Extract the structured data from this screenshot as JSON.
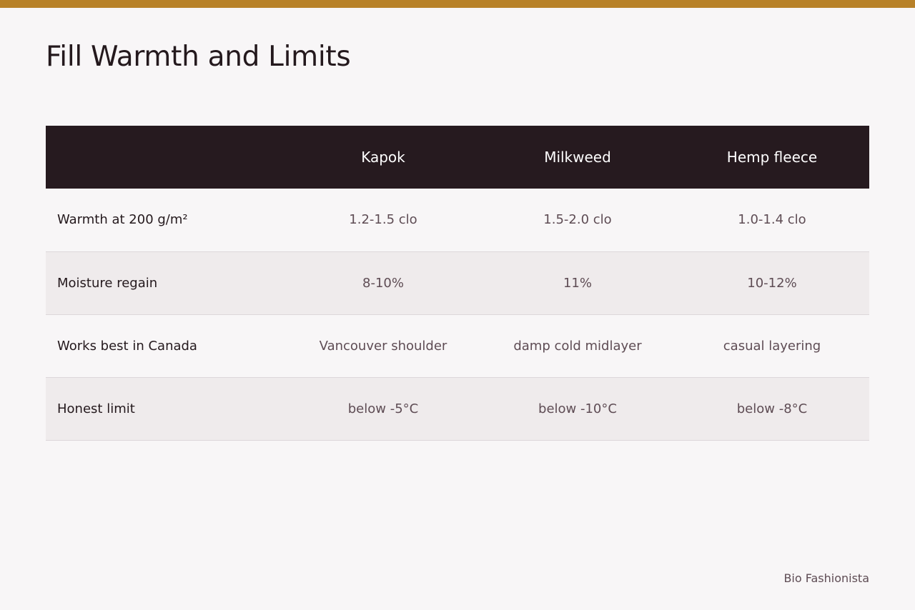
{
  "page": {
    "title": "Fill Warmth and Limits",
    "brand": "Bio Fashionista",
    "accent_color": "#b88128",
    "header_bg_color": "#261a1f"
  },
  "table": {
    "columns": [
      "",
      "Kapok",
      "Milkweed",
      "Hemp fleece"
    ],
    "rows": [
      {
        "label": "Warmth at 200 g/m²",
        "values": [
          "1.2-1.5 clo",
          "1.5-2.0 clo",
          "1.0-1.4 clo"
        ]
      },
      {
        "label": "Moisture regain",
        "values": [
          "8-10%",
          "11%",
          "10-12%"
        ]
      },
      {
        "label": "Works best in Canada",
        "values": [
          "Vancouver shoulder",
          "damp cold midlayer",
          "casual layering"
        ]
      },
      {
        "label": "Honest limit",
        "values": [
          "below -5°C",
          "below -10°C",
          "below -8°C"
        ]
      }
    ]
  }
}
